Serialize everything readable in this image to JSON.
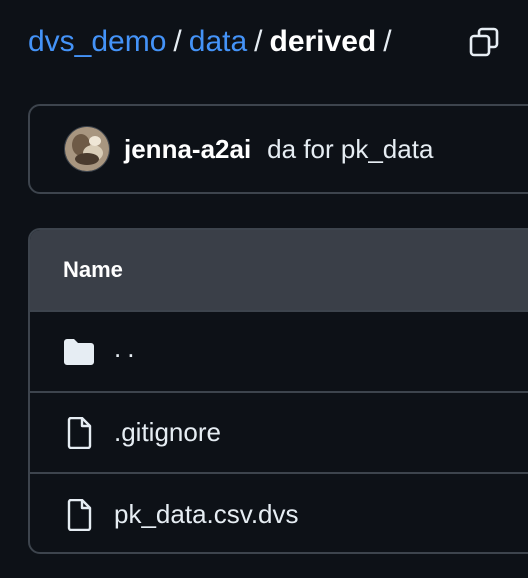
{
  "breadcrumb": {
    "repo": "dvs_demo",
    "separator": "/",
    "folder": "data",
    "current": "derived"
  },
  "commit": {
    "author": "jenna-a2ai",
    "message": "da for pk_data"
  },
  "table": {
    "header": "Name",
    "rows": [
      {
        "label": "..",
        "icon": "folder-icon"
      },
      {
        "label": ".gitignore",
        "icon": "file-icon"
      },
      {
        "label": "pk_data.csv.dvs",
        "icon": "file-icon"
      }
    ]
  },
  "colors": {
    "background": "#0d1117",
    "link": "#4493f8",
    "border": "#3d444d",
    "header_bg": "#3a3f48"
  }
}
